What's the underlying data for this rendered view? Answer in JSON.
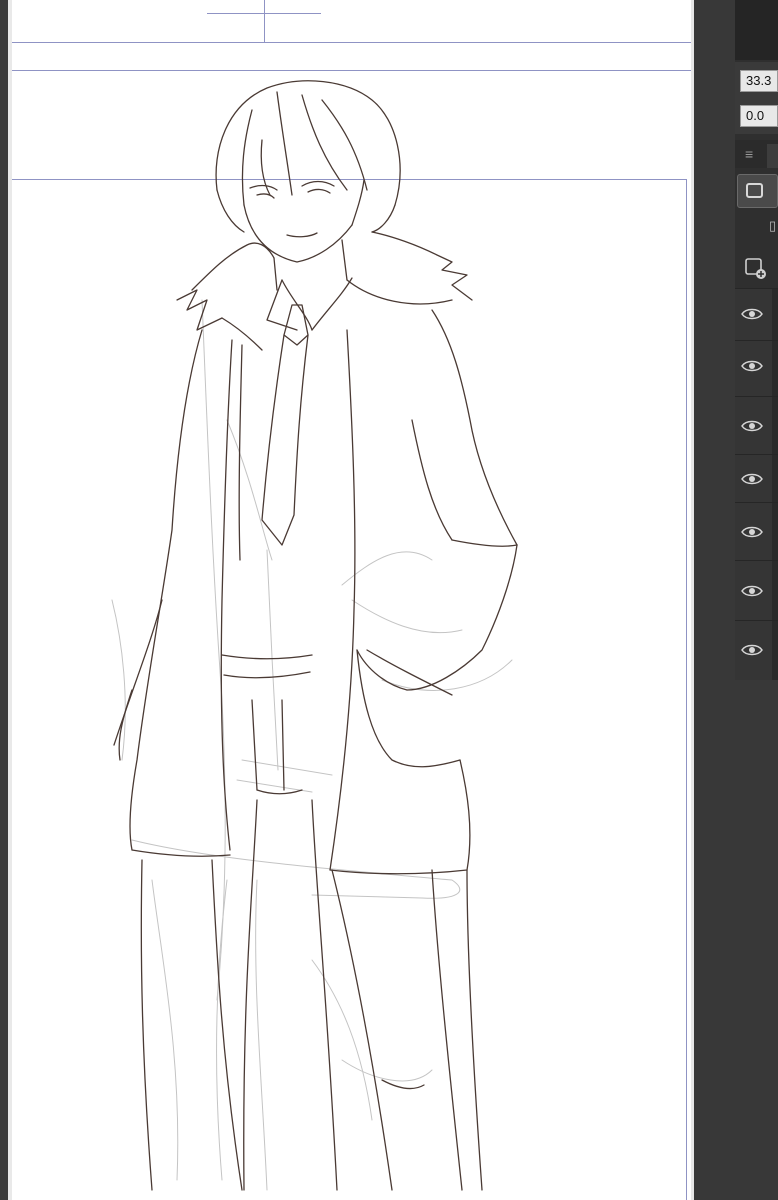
{
  "toolbar": {
    "value_one": "33.3",
    "value_two": "0.0",
    "menu_icon": "hamburger-menu-icon"
  },
  "tools": {
    "selection": "rectangle-select-icon",
    "new_layer": "new-layer-icon"
  },
  "layers": [
    {
      "visible": true,
      "icon": "eye-icon"
    },
    {
      "visible": true,
      "icon": "eye-icon"
    },
    {
      "visible": true,
      "icon": "eye-icon"
    },
    {
      "visible": true,
      "icon": "eye-icon"
    },
    {
      "visible": true,
      "icon": "eye-icon"
    },
    {
      "visible": true,
      "icon": "eye-icon"
    },
    {
      "visible": true,
      "icon": "eye-icon"
    }
  ],
  "colors": {
    "guide": "#8f93c4",
    "sketch_line": "#4a3a34",
    "rough_line": "#b8b8b8",
    "panel": "#2f2f2f"
  }
}
